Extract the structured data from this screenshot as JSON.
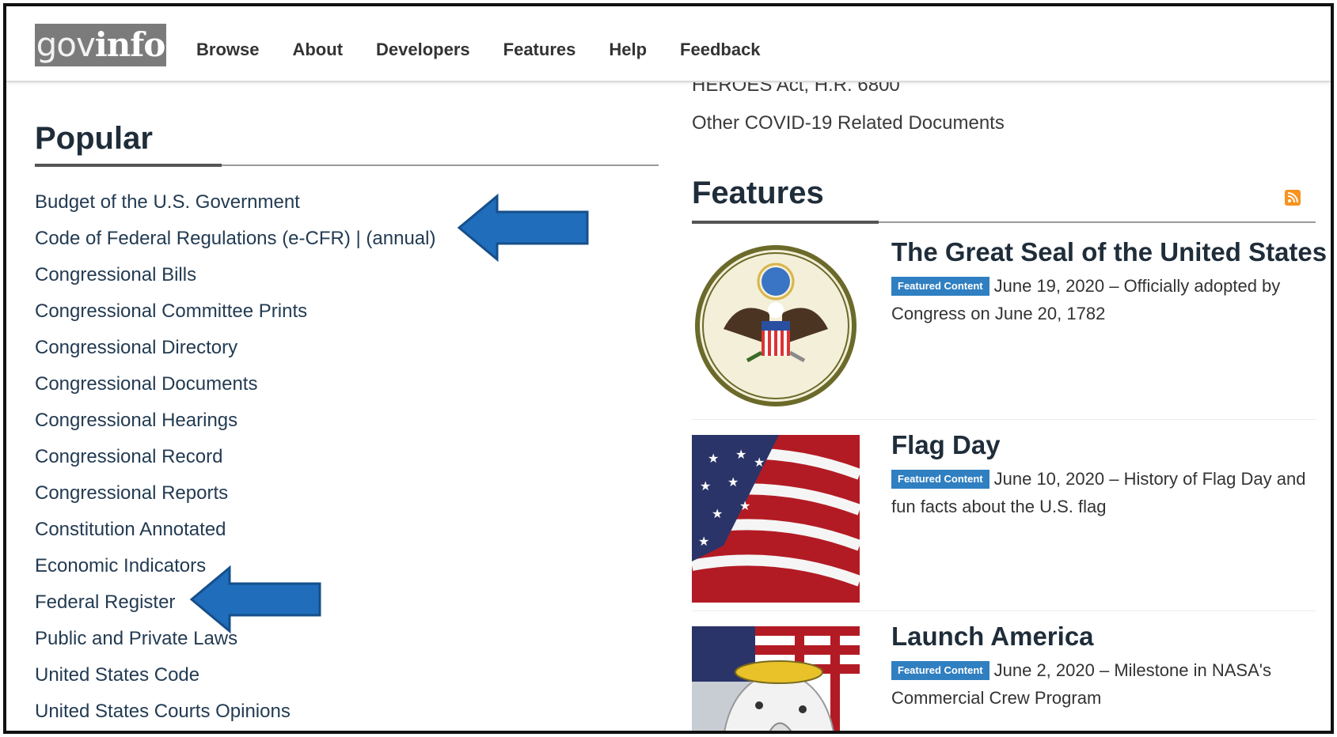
{
  "header": {
    "logo_gov": "gov",
    "logo_info": "info",
    "nav": [
      "Browse",
      "About",
      "Developers",
      "Features",
      "Help",
      "Feedback"
    ]
  },
  "popular": {
    "title": "Popular",
    "items": [
      "Budget of the U.S. Government",
      "Code of Federal Regulations (e-CFR) | (annual)",
      "Congressional Bills",
      "Congressional Committee Prints",
      "Congressional Directory",
      "Congressional Documents",
      "Congressional Hearings",
      "Congressional Record",
      "Congressional Reports",
      "Constitution Annotated",
      "Economic Indicators",
      "Federal Register",
      "Public and Private Laws",
      "United States Code",
      "United States Courts Opinions"
    ]
  },
  "covid": {
    "cut_item": "HEROES Act, H.R. 6800",
    "other": "Other COVID-19 Related Documents"
  },
  "features": {
    "title": "Features",
    "rss_icon": "rss-icon",
    "badge": "Featured Content",
    "items": [
      {
        "title": "The Great Seal of the United States",
        "date": "June 19, 2020",
        "desc": "Officially adopted by Congress on June 20, 1782"
      },
      {
        "title": "Flag Day",
        "date": "June 10, 2020",
        "desc": "History of Flag Day and fun facts about the U.S. flag"
      },
      {
        "title": "Launch America",
        "date": "June 2, 2020",
        "desc": "Milestone in NASA's Commercial Crew Program"
      }
    ]
  },
  "colors": {
    "arrow": "#1f6dbb",
    "badge": "#2f7fc1",
    "rss": "#f7931e"
  }
}
